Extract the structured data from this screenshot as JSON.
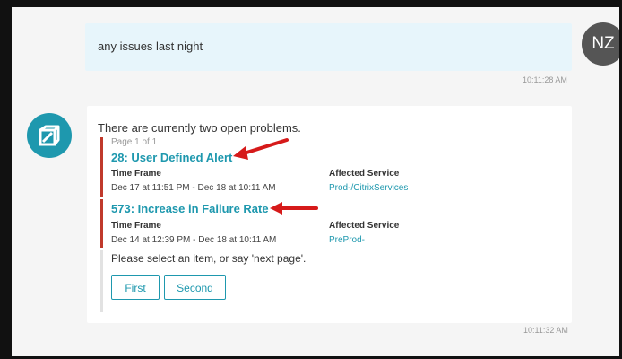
{
  "user_message": {
    "text": "any issues last night",
    "avatar_initials": "NZ",
    "timestamp": "10:11:28 AM"
  },
  "bot_message": {
    "intro": "There are currently two open problems.",
    "page_info": "Page 1 of 1",
    "problems": [
      {
        "title": "28: User Defined Alert",
        "time_frame_label": "Time Frame",
        "time_frame": "Dec 17 at 11:51 PM - Dec 18 at 10:11 AM",
        "affected_label": "Affected Service",
        "affected_service": "Prod-/CitrixServices"
      },
      {
        "title": "573: Increase in Failure Rate",
        "time_frame_label": "Time Frame",
        "time_frame": "Dec 14 at 12:39 PM - Dec 18 at 10:11 AM",
        "affected_label": "Affected Service",
        "affected_service": "PreProd-"
      }
    ],
    "prompt": "Please select an item, or say 'next page'.",
    "buttons": [
      "First",
      "Second"
    ],
    "timestamp": "10:11:32 AM"
  },
  "colors": {
    "accent": "#1e98ae",
    "problem_bar": "#c0392b",
    "annotation_arrow": "#d61a1a",
    "user_bubble": "#e7f5fb",
    "background": "#f5f5f5"
  },
  "icons": {
    "bot": "cube-icon",
    "annotation": "red-arrow-icon"
  }
}
